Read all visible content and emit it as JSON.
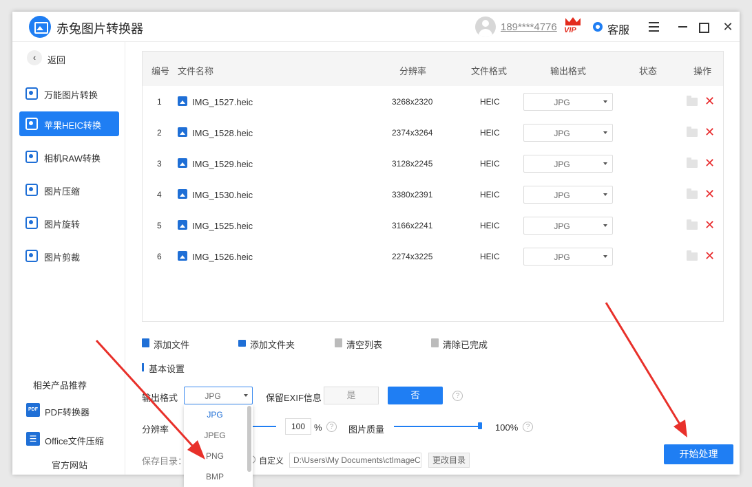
{
  "app": {
    "title": "赤兔图片转换器",
    "username": "189****4776",
    "vip": "VIP",
    "service": "客服",
    "close_glyph": "✕"
  },
  "sidebar": {
    "back": "返回",
    "back_glyph": "‹",
    "items": [
      {
        "label": "万能图片转换",
        "icon": "image-convert-icon",
        "active": false
      },
      {
        "label": "苹果HEIC转换",
        "icon": "heic-icon",
        "active": true
      },
      {
        "label": "相机RAW转换",
        "icon": "raw-icon",
        "active": false
      },
      {
        "label": "图片压缩",
        "icon": "compress-icon",
        "active": false
      },
      {
        "label": "图片旋转",
        "icon": "rotate-icon",
        "active": false
      },
      {
        "label": "图片剪裁",
        "icon": "crop-icon",
        "active": false
      }
    ],
    "related_title": "相关产品推荐",
    "related": [
      {
        "label": "PDF转换器",
        "icon_text": "PDF"
      },
      {
        "label": "Office文件压缩",
        "icon_text": "☰"
      }
    ],
    "official_site": "官方网站"
  },
  "table": {
    "headers": {
      "index": "编号",
      "name": "文件名称",
      "resolution": "分辨率",
      "format": "文件格式",
      "output_format": "输出格式",
      "status": "状态",
      "actions": "操作"
    },
    "rows": [
      {
        "index": "1",
        "name": "IMG_1527.heic",
        "resolution": "3268x2320",
        "format": "HEIC",
        "output": "JPG"
      },
      {
        "index": "2",
        "name": "IMG_1528.heic",
        "resolution": "2374x3264",
        "format": "HEIC",
        "output": "JPG"
      },
      {
        "index": "3",
        "name": "IMG_1529.heic",
        "resolution": "3128x2245",
        "format": "HEIC",
        "output": "JPG"
      },
      {
        "index": "4",
        "name": "IMG_1530.heic",
        "resolution": "3380x2391",
        "format": "HEIC",
        "output": "JPG"
      },
      {
        "index": "5",
        "name": "IMG_1525.heic",
        "resolution": "3166x2241",
        "format": "HEIC",
        "output": "JPG"
      },
      {
        "index": "6",
        "name": "IMG_1526.heic",
        "resolution": "2274x3225",
        "format": "HEIC",
        "output": "JPG"
      }
    ],
    "delete_glyph": "✕"
  },
  "toolbar": {
    "add_file": "添加文件",
    "add_folder": "添加文件夹",
    "clear_list": "清空列表",
    "clear_done": "清除已完成"
  },
  "settings": {
    "title": "基本设置",
    "output_format_label": "输出格式",
    "output_format_value": "JPG",
    "format_options": [
      "JPG",
      "JPEG",
      "PNG",
      "BMP"
    ],
    "exif_label": "保留EXIF信息",
    "exif_yes": "是",
    "exif_no": "否",
    "help_glyph": "?",
    "resolution_label": "分辨率",
    "resolution_value": "100",
    "resolution_unit": "%",
    "quality_label": "图片质量",
    "quality_value": "100%",
    "quality_level": 1.0,
    "save_dir_label": "保存目录：",
    "custom_label": "自定义",
    "save_path": "D:\\Users\\My Documents\\ctImageC",
    "change_dir": "更改目录",
    "start": "开始处理"
  },
  "colors": {
    "accent": "#1f7ef3",
    "delete": "#e8292b",
    "annotation_arrow": "#e8302a"
  }
}
